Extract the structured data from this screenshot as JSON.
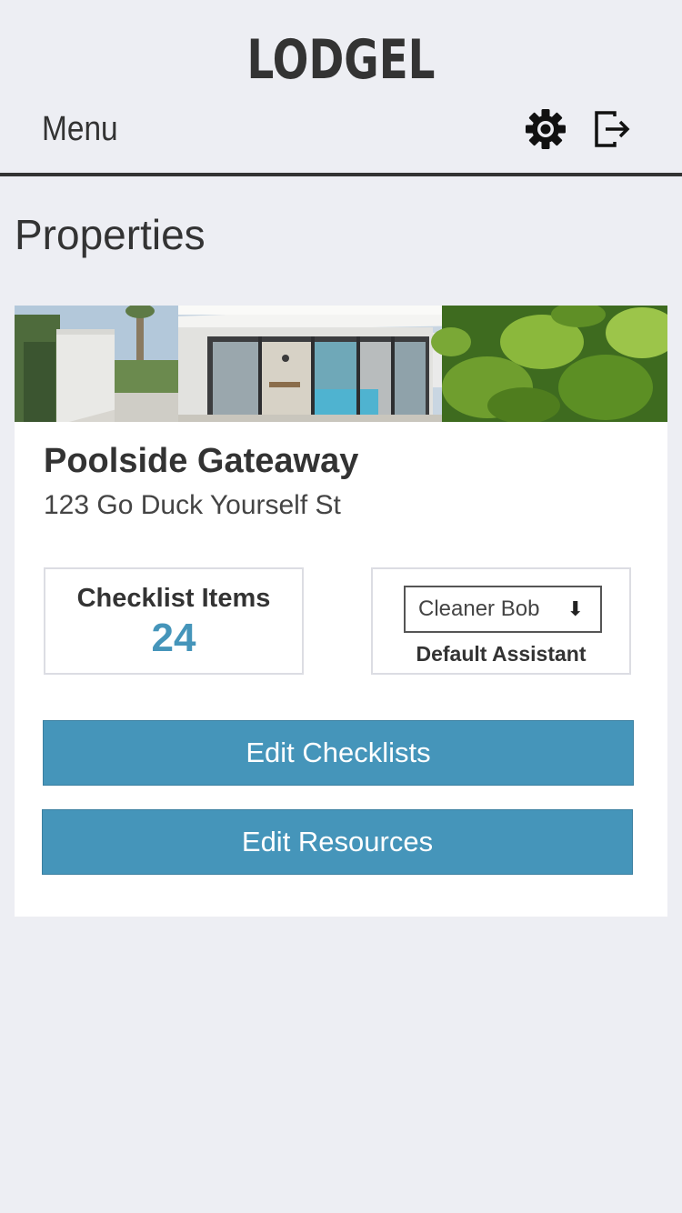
{
  "header": {
    "app_title": "LODGEL",
    "menu_label": "Menu",
    "settings_icon": "gear-icon",
    "logout_icon": "logout-icon"
  },
  "page": {
    "title": "Properties"
  },
  "property": {
    "name": "Poolside Gateaway",
    "address": "123 Go Duck Yourself St",
    "checklist": {
      "label": "Checklist Items",
      "count": "24"
    },
    "assistant": {
      "selected": "Cleaner Bob",
      "arrow": "⬇",
      "caption": "Default Assistant"
    },
    "buttons": {
      "edit_checklists": "Edit Checklists",
      "edit_resources": "Edit Resources"
    }
  },
  "colors": {
    "background": "#edeef3",
    "text": "#333333",
    "accent": "#4595ba",
    "card": "#ffffff"
  }
}
